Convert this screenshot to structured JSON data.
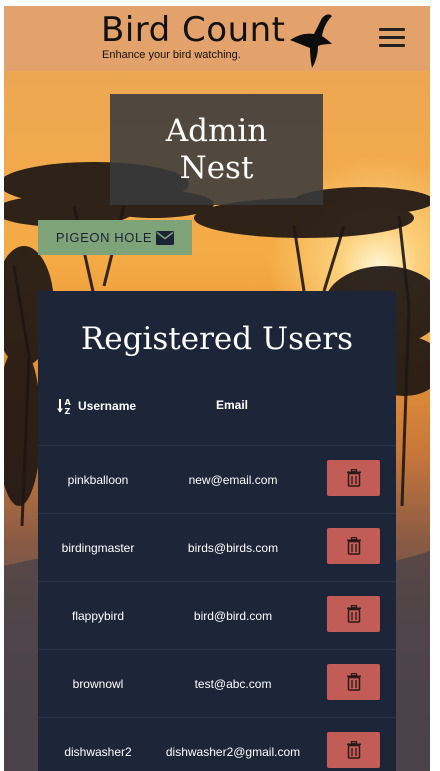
{
  "header": {
    "title": "Bird Count",
    "tagline": "Enhance your bird watching.",
    "logo_icon": "flying-bird-icon",
    "menu_icon": "hamburger-menu-icon"
  },
  "hero": {
    "heading_line1": "Admin",
    "heading_line2": "Nest"
  },
  "pigeon_hole": {
    "label": "PIGEON HOLE",
    "icon": "envelope-icon",
    "color": "#7fa379"
  },
  "users_panel": {
    "title": "Registered Users",
    "columns": {
      "username": "Username",
      "email": "Email",
      "sort_icon": "sort-alpha-down-icon"
    },
    "rows": [
      {
        "username": "pinkballoon",
        "email": "new@email.com"
      },
      {
        "username": "birdingmaster",
        "email": "birds@birds.com"
      },
      {
        "username": "flappybird",
        "email": "bird@bird.com"
      },
      {
        "username": "brownowl",
        "email": "test@abc.com"
      },
      {
        "username": "dishwasher2",
        "email": "dishwasher2@gmail.com"
      }
    ],
    "delete_icon": "trash-icon",
    "delete_color": "#c15c56",
    "panel_color": "#1d2538"
  }
}
